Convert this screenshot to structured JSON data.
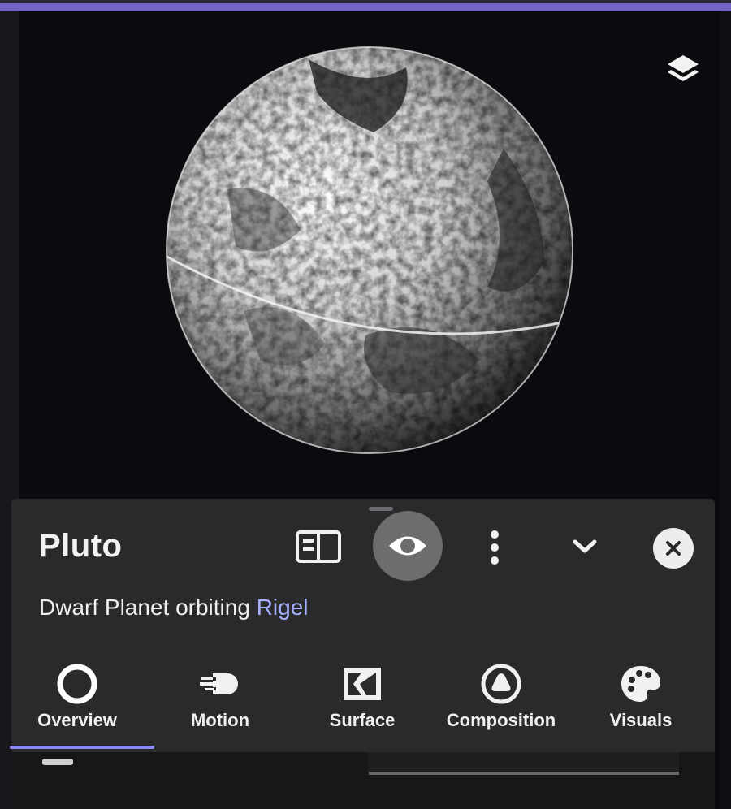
{
  "object": {
    "name": "Pluto",
    "type_label": "Dwarf Planet orbiting",
    "parent_link": "Rigel"
  },
  "toolbar": {
    "layers_icon": "layers-icon",
    "sidebar_icon": "panel-sidebar-icon",
    "eye_icon": "eye-icon",
    "more_icon": "more-vertical-icon",
    "collapse_icon": "chevron-down-icon",
    "close_icon": "close-icon"
  },
  "tabs": [
    {
      "label": "Overview",
      "icon": "ring-icon",
      "selected": true
    },
    {
      "label": "Motion",
      "icon": "motion-icon",
      "selected": false
    },
    {
      "label": "Surface",
      "icon": "surface-icon",
      "selected": false
    },
    {
      "label": "Composition",
      "icon": "composition-icon",
      "selected": false
    },
    {
      "label": "Visuals",
      "icon": "palette-icon",
      "selected": false
    }
  ],
  "colors": {
    "accent": "#8c8cf0",
    "link": "#a7b0ff",
    "panel": "#2a2a2d",
    "background": "#0b0a0d"
  }
}
